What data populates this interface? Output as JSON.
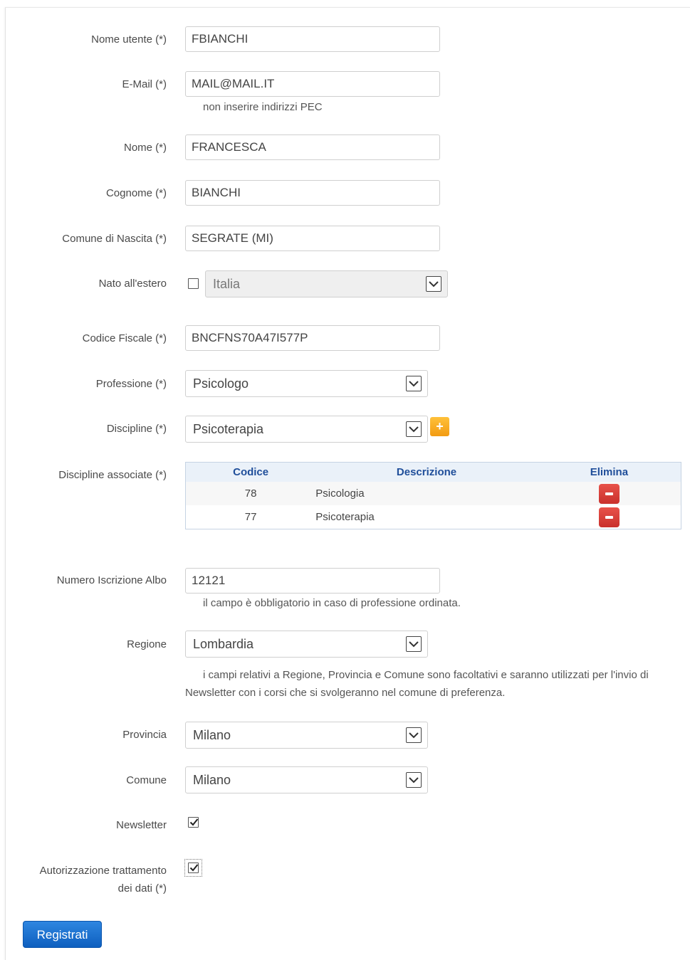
{
  "form": {
    "username": {
      "label": "Nome utente (*)",
      "value": "FBIANCHI"
    },
    "email": {
      "label": "E-Mail (*)",
      "value": "MAIL@MAIL.IT",
      "hint": "non inserire indirizzi PEC"
    },
    "first_name": {
      "label": "Nome (*)",
      "value": "FRANCESCA"
    },
    "last_name": {
      "label": "Cognome (*)",
      "value": "BIANCHI"
    },
    "birth_city": {
      "label": "Comune di Nascita (*)",
      "value": "SEGRATE (MI)"
    },
    "born_abroad": {
      "label": "Nato all'estero",
      "checked": false,
      "country": "Italia"
    },
    "tax_code": {
      "label": "Codice Fiscale (*)",
      "value": "BNCFNS70A47I577P"
    },
    "profession": {
      "label": "Professione (*)",
      "value": "Psicologo"
    },
    "discipline": {
      "label": "Discipline (*)",
      "value": "Psicoterapia",
      "add_icon": "plus-icon"
    },
    "associated": {
      "label": "Discipline associate (*)",
      "headers": [
        "Codice",
        "Descrizione",
        "Elimina"
      ],
      "rows": [
        {
          "code": "78",
          "description": "Psicologia",
          "delete_icon": "minus-icon"
        },
        {
          "code": "77",
          "description": "Psicoterapia",
          "delete_icon": "minus-icon"
        }
      ]
    },
    "register_number": {
      "label": "Numero Iscrizione Albo",
      "value": "12121",
      "hint": "il campo è obbligatorio in caso di professione ordinata."
    },
    "region": {
      "label": "Regione",
      "value": "Lombardia",
      "hint_line1": "i campi relativi a Regione, Provincia e Comune sono facoltativi e saranno utilizzati per l'invio di",
      "hint_line2": "Newsletter con i corsi che si svolgeranno nel comune di preferenza."
    },
    "province": {
      "label": "Provincia",
      "value": "Milano"
    },
    "city": {
      "label": "Comune",
      "value": "Milano"
    },
    "newsletter": {
      "label": "Newsletter",
      "checked": true
    },
    "privacy": {
      "label_line1": "Autorizzazione trattamento",
      "label_line2": "dei dati (*)",
      "checked": true
    },
    "submit_label": "Registrati"
  },
  "colors": {
    "header_text": "#1f4e9a",
    "delete_button": "#d9363e",
    "add_button": "#f6a623",
    "submit_button": "#1a6fd0"
  }
}
